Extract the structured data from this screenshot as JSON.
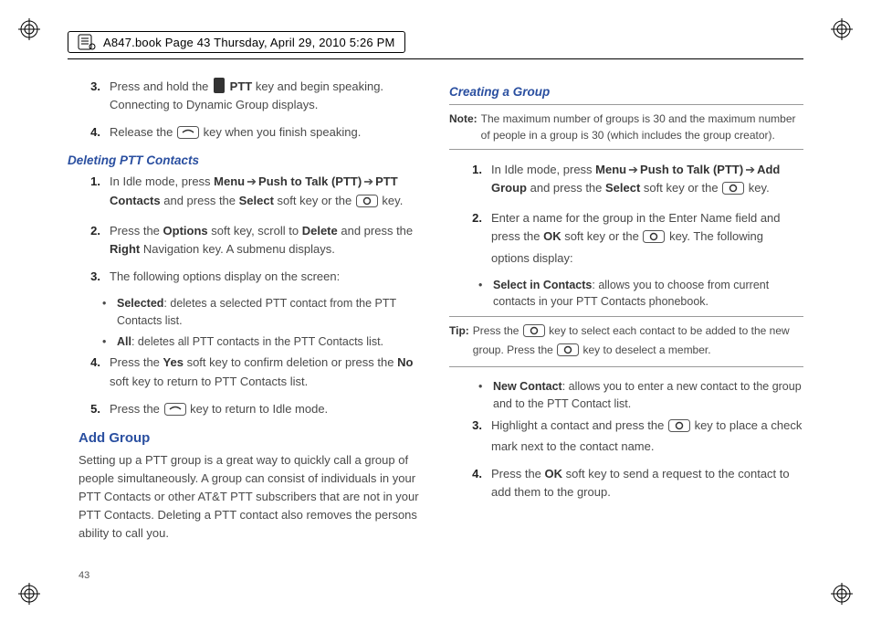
{
  "header": {
    "text": "A847.book  Page 43  Thursday, April 29, 2010  5:26 PM"
  },
  "pageNumber": "43",
  "left": {
    "step3": "Press and hold the ",
    "step3b": " key and begin speaking. Connecting to Dynamic Group displays.",
    "pttLabel": "PTT",
    "step4a": "Release the ",
    "step4b": " key when you finish speaking.",
    "sec_deleting": "Deleting PTT Contacts",
    "d1a": "In Idle mode, press ",
    "d1_menu": "Menu",
    "d1_ptt": "Push to Talk (PTT)",
    "d1_contacts": "PTT Contacts",
    "d1b": " and press the ",
    "d1_select": "Select",
    "d1c": " soft key or the ",
    "d1d": " key.",
    "d2a": "Press the ",
    "d2_options": "Options",
    "d2b": " soft key, scroll to ",
    "d2_delete": "Delete",
    "d2c": " and press the ",
    "d2_right": "Right",
    "d2d": " Navigation key. A submenu displays.",
    "d3": "The following options display on the screen:",
    "b_sel_label": "Selected",
    "b_sel": ": deletes a selected PTT contact from the PTT Contacts list.",
    "b_all_label": "All",
    "b_all": ": deletes all PTT contacts in the PTT Contacts list.",
    "d4a": "Press the ",
    "d4_yes": "Yes",
    "d4b": " soft key to confirm deletion or press the ",
    "d4_no": "No",
    "d4c": " soft key to return to PTT Contacts list.",
    "d5a": "Press the ",
    "d5b": " key to return to Idle mode.",
    "sec_add": "Add Group",
    "add_para": "Setting up a PTT group is a great way to quickly call a group of people simultaneously. A group can consist of individuals in your PTT Contacts or other AT&T PTT subscribers that are not in your PTT Contacts. Deleting a PTT contact also removes the persons ability to call you."
  },
  "right": {
    "sec_creating": "Creating a Group",
    "note_label": "Note:",
    "note_body": "The maximum number of groups is 30 and the maximum number of people in a group is 30 (which includes the group creator).",
    "c1a": "In Idle mode, press ",
    "c1_menu": "Menu",
    "c1_ptt": "Push to Talk (PTT)",
    "c1_add": "Add Group",
    "c1b": " and press the ",
    "c1_select": "Select",
    "c1c": " soft key or the ",
    "c1d": " key.",
    "c2a": "Enter a name for the group in the Enter Name field and press the ",
    "c2_ok": "OK",
    "c2b": " soft key or the ",
    "c2c": " key. The following options display:",
    "b_sic_label": "Select in Contacts",
    "b_sic": ": allows you to choose from current contacts in your PTT Contacts phonebook.",
    "tip_label": "Tip:",
    "tip1a": "Press the ",
    "tip1b": " key to select each contact to be added to the new group. Press the ",
    "tip1c": " key to deselect a member.",
    "b_new_label": "New Contact",
    "b_new": ": allows you to enter a new contact to the group and to the PTT Contact list.",
    "c3a": "Highlight a contact and press the ",
    "c3b": " key to place a check mark next to the contact name.",
    "c4a": "Press the ",
    "c4_ok": "OK",
    "c4b": " soft key to send a request to the contact to add them to the group."
  },
  "nums": {
    "n1": "1.",
    "n2": "2.",
    "n3": "3.",
    "n4": "4.",
    "n5": "5."
  }
}
